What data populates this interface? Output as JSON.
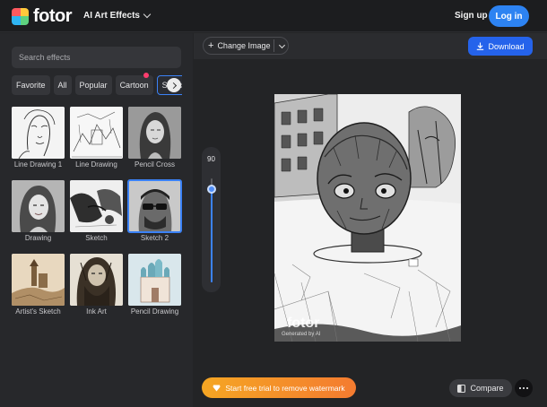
{
  "header": {
    "logo_text": "fotor",
    "menu_label": "AI Art Effects",
    "signup_label": "Sign up",
    "login_label": "Log in"
  },
  "sidebar": {
    "search_placeholder": "Search effects",
    "tabs": [
      "Favorite",
      "All",
      "Popular",
      "Cartoon",
      "Sketch"
    ],
    "active_tab": "Sketch",
    "effects": [
      {
        "label": "Line Drawing 1"
      },
      {
        "label": "Line Drawing"
      },
      {
        "label": "Pencil Cross"
      },
      {
        "label": "Drawing"
      },
      {
        "label": "Sketch"
      },
      {
        "label": "Sketch 2",
        "selected": true
      },
      {
        "label": "Artist's Sketch"
      },
      {
        "label": "Ink Art"
      },
      {
        "label": "Pencil Drawing"
      }
    ]
  },
  "toolbar": {
    "change_image_label": "Change Image",
    "download_label": "Download"
  },
  "canvas": {
    "intensity_value": "90",
    "intensity_level": 0.9,
    "watermark_text": "fotor",
    "watermark_sub": "Generated by AI",
    "trial_label": "Start free trial to remove watermark",
    "compare_label": "Compare"
  },
  "colors": {
    "accent": "#2563eb",
    "login": "#2d83f2",
    "trial_start": "#f5a623",
    "trial_end": "#f47b30"
  }
}
